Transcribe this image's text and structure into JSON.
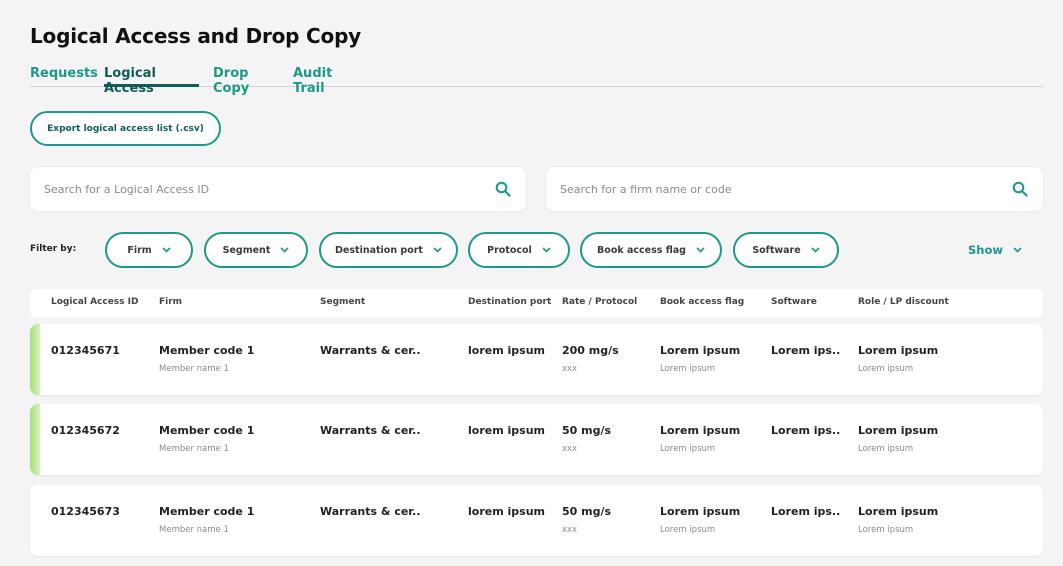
{
  "page": {
    "title": "Logical Access and Drop Copy"
  },
  "tabs": [
    {
      "label": "Requests",
      "active": false
    },
    {
      "label": "Logical Access",
      "active": true
    },
    {
      "label": "Drop Copy",
      "active": false
    },
    {
      "label": "Audit Trail",
      "active": false
    }
  ],
  "toolbar": {
    "export_label": "Export logical access list (.csv)"
  },
  "search": {
    "access_id_placeholder": "Search for a Logical Access ID",
    "firm_placeholder": "Search for a firm name or code",
    "icon": "search-icon"
  },
  "filters": {
    "label": "Filter by:",
    "items": [
      "Firm",
      "Segment",
      "Destination port",
      "Protocol",
      "Book access flag",
      "Software"
    ],
    "show_label": "Show"
  },
  "table": {
    "columns": [
      "Logical Access ID",
      "Firm",
      "Segment",
      "Destination port",
      "Rate / Protocol",
      "Book access flag",
      "Software",
      "Role / LP discount"
    ],
    "rows": [
      {
        "id": "012345671",
        "firm": "Member code 1",
        "firm_sub": "Member name 1",
        "segment": "Warrants & cer..",
        "port": "lorem ipsum",
        "rate": "200 mg/s",
        "rate_sub": "xxx",
        "book": "Lorem ipsum",
        "book_sub": "Lorem ipsum",
        "software": "Lorem ips..",
        "role": "Lorem ipsum",
        "role_sub": "Lorem ipsum",
        "highlight": true
      },
      {
        "id": "012345672",
        "firm": "Member code 1",
        "firm_sub": "Member name 1",
        "segment": "Warrants & cer..",
        "port": "lorem ipsum",
        "rate": "50 mg/s",
        "rate_sub": "xxx",
        "book": "Lorem ipsum",
        "book_sub": "Lorem ipsum",
        "software": "Lorem ips..",
        "role": "Lorem ipsum",
        "role_sub": "Lorem ipsum",
        "highlight": true
      },
      {
        "id": "012345673",
        "firm": "Member code 1",
        "firm_sub": "Member name 1",
        "segment": "Warrants & cer..",
        "port": "lorem ipsum",
        "rate": "50 mg/s",
        "rate_sub": "xxx",
        "book": "Lorem ipsum",
        "book_sub": "Lorem ipsum",
        "software": "Lorem ips..",
        "role": "Lorem ipsum",
        "role_sub": "Lorem ipsum",
        "highlight": false
      }
    ]
  },
  "colors": {
    "accent": "#1b998b",
    "accent_dark": "#0f5d58",
    "row_highlight": "#a5e07a",
    "background": "#f4f4f4"
  }
}
